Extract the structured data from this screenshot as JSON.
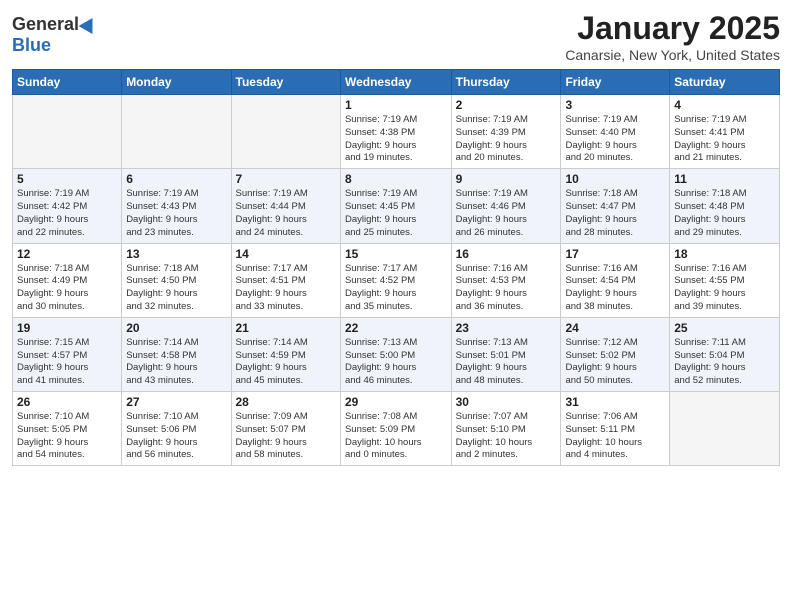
{
  "header": {
    "logo_general": "General",
    "logo_blue": "Blue",
    "month": "January 2025",
    "location": "Canarsie, New York, United States"
  },
  "weekdays": [
    "Sunday",
    "Monday",
    "Tuesday",
    "Wednesday",
    "Thursday",
    "Friday",
    "Saturday"
  ],
  "weeks": [
    [
      {
        "day": "",
        "info": ""
      },
      {
        "day": "",
        "info": ""
      },
      {
        "day": "",
        "info": ""
      },
      {
        "day": "1",
        "info": "Sunrise: 7:19 AM\nSunset: 4:38 PM\nDaylight: 9 hours\nand 19 minutes."
      },
      {
        "day": "2",
        "info": "Sunrise: 7:19 AM\nSunset: 4:39 PM\nDaylight: 9 hours\nand 20 minutes."
      },
      {
        "day": "3",
        "info": "Sunrise: 7:19 AM\nSunset: 4:40 PM\nDaylight: 9 hours\nand 20 minutes."
      },
      {
        "day": "4",
        "info": "Sunrise: 7:19 AM\nSunset: 4:41 PM\nDaylight: 9 hours\nand 21 minutes."
      }
    ],
    [
      {
        "day": "5",
        "info": "Sunrise: 7:19 AM\nSunset: 4:42 PM\nDaylight: 9 hours\nand 22 minutes."
      },
      {
        "day": "6",
        "info": "Sunrise: 7:19 AM\nSunset: 4:43 PM\nDaylight: 9 hours\nand 23 minutes."
      },
      {
        "day": "7",
        "info": "Sunrise: 7:19 AM\nSunset: 4:44 PM\nDaylight: 9 hours\nand 24 minutes."
      },
      {
        "day": "8",
        "info": "Sunrise: 7:19 AM\nSunset: 4:45 PM\nDaylight: 9 hours\nand 25 minutes."
      },
      {
        "day": "9",
        "info": "Sunrise: 7:19 AM\nSunset: 4:46 PM\nDaylight: 9 hours\nand 26 minutes."
      },
      {
        "day": "10",
        "info": "Sunrise: 7:18 AM\nSunset: 4:47 PM\nDaylight: 9 hours\nand 28 minutes."
      },
      {
        "day": "11",
        "info": "Sunrise: 7:18 AM\nSunset: 4:48 PM\nDaylight: 9 hours\nand 29 minutes."
      }
    ],
    [
      {
        "day": "12",
        "info": "Sunrise: 7:18 AM\nSunset: 4:49 PM\nDaylight: 9 hours\nand 30 minutes."
      },
      {
        "day": "13",
        "info": "Sunrise: 7:18 AM\nSunset: 4:50 PM\nDaylight: 9 hours\nand 32 minutes."
      },
      {
        "day": "14",
        "info": "Sunrise: 7:17 AM\nSunset: 4:51 PM\nDaylight: 9 hours\nand 33 minutes."
      },
      {
        "day": "15",
        "info": "Sunrise: 7:17 AM\nSunset: 4:52 PM\nDaylight: 9 hours\nand 35 minutes."
      },
      {
        "day": "16",
        "info": "Sunrise: 7:16 AM\nSunset: 4:53 PM\nDaylight: 9 hours\nand 36 minutes."
      },
      {
        "day": "17",
        "info": "Sunrise: 7:16 AM\nSunset: 4:54 PM\nDaylight: 9 hours\nand 38 minutes."
      },
      {
        "day": "18",
        "info": "Sunrise: 7:16 AM\nSunset: 4:55 PM\nDaylight: 9 hours\nand 39 minutes."
      }
    ],
    [
      {
        "day": "19",
        "info": "Sunrise: 7:15 AM\nSunset: 4:57 PM\nDaylight: 9 hours\nand 41 minutes."
      },
      {
        "day": "20",
        "info": "Sunrise: 7:14 AM\nSunset: 4:58 PM\nDaylight: 9 hours\nand 43 minutes."
      },
      {
        "day": "21",
        "info": "Sunrise: 7:14 AM\nSunset: 4:59 PM\nDaylight: 9 hours\nand 45 minutes."
      },
      {
        "day": "22",
        "info": "Sunrise: 7:13 AM\nSunset: 5:00 PM\nDaylight: 9 hours\nand 46 minutes."
      },
      {
        "day": "23",
        "info": "Sunrise: 7:13 AM\nSunset: 5:01 PM\nDaylight: 9 hours\nand 48 minutes."
      },
      {
        "day": "24",
        "info": "Sunrise: 7:12 AM\nSunset: 5:02 PM\nDaylight: 9 hours\nand 50 minutes."
      },
      {
        "day": "25",
        "info": "Sunrise: 7:11 AM\nSunset: 5:04 PM\nDaylight: 9 hours\nand 52 minutes."
      }
    ],
    [
      {
        "day": "26",
        "info": "Sunrise: 7:10 AM\nSunset: 5:05 PM\nDaylight: 9 hours\nand 54 minutes."
      },
      {
        "day": "27",
        "info": "Sunrise: 7:10 AM\nSunset: 5:06 PM\nDaylight: 9 hours\nand 56 minutes."
      },
      {
        "day": "28",
        "info": "Sunrise: 7:09 AM\nSunset: 5:07 PM\nDaylight: 9 hours\nand 58 minutes."
      },
      {
        "day": "29",
        "info": "Sunrise: 7:08 AM\nSunset: 5:09 PM\nDaylight: 10 hours\nand 0 minutes."
      },
      {
        "day": "30",
        "info": "Sunrise: 7:07 AM\nSunset: 5:10 PM\nDaylight: 10 hours\nand 2 minutes."
      },
      {
        "day": "31",
        "info": "Sunrise: 7:06 AM\nSunset: 5:11 PM\nDaylight: 10 hours\nand 4 minutes."
      },
      {
        "day": "",
        "info": ""
      }
    ]
  ]
}
